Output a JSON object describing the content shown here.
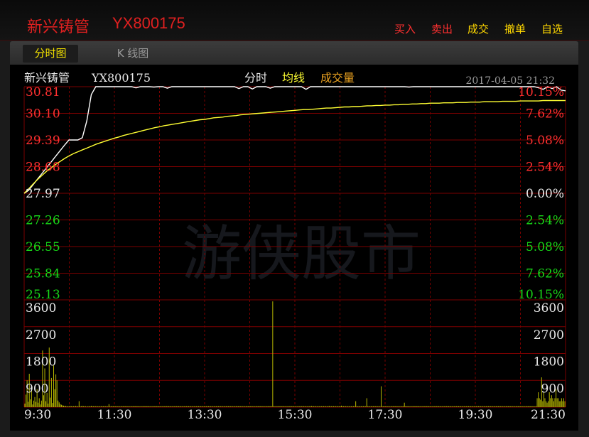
{
  "header": {
    "stock_name": "新兴铸管",
    "stock_code": "YX800175",
    "actions": [
      {
        "label": "买入",
        "color": "#ff3030"
      },
      {
        "label": "卖出",
        "color": "#ff3030"
      },
      {
        "label": "成交",
        "color": "#ffd800"
      },
      {
        "label": "撤单",
        "color": "#ffd800"
      },
      {
        "label": "自选",
        "color": "#ffd800"
      }
    ]
  },
  "tabs": [
    {
      "label": "分时图",
      "active": true
    },
    {
      "label": "K 线图",
      "active": false
    }
  ],
  "chart_info": {
    "name": "新兴铸管",
    "code": "YX800175",
    "legend_label": "分时",
    "legend_avg": "均线",
    "legend_vol": "成交量",
    "datetime": "2017-04-05 21:32"
  },
  "watermark": "游侠股市",
  "colors": {
    "up": "#ff3030",
    "down": "#18d818",
    "price_line": "#ffffff",
    "avg_line": "#ffff33",
    "volume": "#b8b800",
    "grid": "#7a0000"
  },
  "chart_data": [
    {
      "type": "line",
      "series": [
        {
          "name": "分时",
          "values": [
            27.97,
            28.05,
            28.2,
            28.35,
            28.5,
            28.65,
            28.8,
            28.95,
            29.1,
            29.25,
            29.39,
            29.39,
            29.39,
            29.45,
            29.9,
            30.6,
            30.81,
            30.81,
            30.81,
            30.81,
            30.81,
            30.81,
            30.81,
            30.81,
            30.81,
            30.78,
            30.81,
            30.81,
            30.81,
            30.8,
            30.81,
            30.81,
            30.77,
            30.81,
            30.81,
            30.81,
            30.81,
            30.81,
            30.81,
            30.81,
            30.81,
            30.81,
            30.81,
            30.81,
            30.81,
            30.81,
            30.81,
            30.81,
            30.76,
            30.81,
            30.81,
            30.75,
            30.81,
            30.81,
            30.81,
            30.77,
            30.81,
            30.81,
            30.81,
            30.81,
            30.81,
            30.81,
            30.81,
            30.74,
            30.81,
            30.81,
            30.81,
            30.81,
            30.81,
            30.81,
            30.81,
            30.81,
            30.81,
            30.81,
            30.81,
            30.81,
            30.81,
            30.81,
            30.81,
            30.81,
            30.81,
            30.81,
            30.81,
            30.81,
            30.81,
            30.81,
            30.8,
            30.81,
            30.81,
            30.81,
            30.81,
            30.81,
            30.81,
            30.81,
            30.81,
            30.81,
            30.81,
            30.81,
            30.81,
            30.81,
            30.81,
            30.81,
            30.81,
            30.81,
            30.81,
            30.81,
            30.81,
            30.81,
            30.81,
            30.81,
            30.81,
            30.81,
            30.81,
            30.81,
            30.81,
            30.78,
            30.74,
            30.81,
            30.76,
            30.81,
            30.72,
            30.7
          ]
        },
        {
          "name": "均线",
          "values": [
            27.97,
            28.09,
            28.22,
            28.34,
            28.45,
            28.56,
            28.65,
            28.74,
            28.82,
            28.9,
            28.97,
            29.03,
            29.08,
            29.13,
            29.18,
            29.23,
            29.28,
            29.32,
            29.36,
            29.4,
            29.44,
            29.47,
            29.51,
            29.54,
            29.57,
            29.6,
            29.63,
            29.66,
            29.69,
            29.72,
            29.74,
            29.77,
            29.79,
            29.81,
            29.83,
            29.85,
            29.87,
            29.89,
            29.91,
            29.93,
            29.94,
            29.96,
            29.98,
            29.99,
            30.0,
            30.02,
            30.03,
            30.04,
            30.06,
            30.07,
            30.08,
            30.09,
            30.1,
            30.11,
            30.12,
            30.13,
            30.14,
            30.15,
            30.16,
            30.17,
            30.18,
            30.19,
            30.2,
            30.2,
            30.21,
            30.22,
            30.23,
            30.24,
            30.24,
            30.25,
            30.26,
            30.27,
            30.27,
            30.28,
            30.28,
            30.29,
            30.3,
            30.3,
            30.31,
            30.31,
            30.32,
            30.32,
            30.33,
            30.33,
            30.34,
            30.34,
            30.35,
            30.35,
            30.36,
            30.36,
            30.37,
            30.37,
            30.37,
            30.38,
            30.38,
            30.38,
            30.39,
            30.39,
            30.39,
            30.4,
            30.4,
            30.4,
            30.41,
            30.41,
            30.41,
            30.41,
            30.42,
            30.42,
            30.42,
            30.42,
            30.43,
            30.43,
            30.43,
            30.43,
            30.43,
            30.44,
            30.44,
            30.44,
            30.44,
            30.44,
            30.44
          ]
        }
      ],
      "x_tick_labels": [
        "9:30",
        "11:30",
        "13:30",
        "15:30",
        "17:30",
        "19:30",
        "21:30"
      ],
      "price_ticks": [
        "30.81",
        "30.10",
        "29.39",
        "28.68",
        "27.97",
        "27.26",
        "26.55",
        "25.84",
        "25.13"
      ],
      "percent_ticks": [
        "10.15%",
        "7.62%",
        "5.08%",
        "2.54%",
        "0.00%",
        "2.54%",
        "5.08%",
        "7.62%",
        "10.15%"
      ],
      "ylim": [
        25.13,
        30.81
      ],
      "grid": true
    },
    {
      "type": "bar",
      "y_tick_labels": [
        "3600",
        "2700",
        "1800",
        "900"
      ],
      "ylim": [
        0,
        3600
      ],
      "values": [
        120,
        420,
        900,
        180,
        1120,
        260,
        640,
        90,
        220,
        340,
        180,
        600,
        150,
        300,
        90,
        220,
        1900,
        400,
        1300,
        200,
        480,
        120,
        2000,
        320,
        980,
        140,
        1400,
        600,
        1100,
        900,
        220,
        160,
        100,
        80,
        60,
        50,
        40,
        40,
        30,
        30,
        30,
        40,
        30,
        30,
        30,
        30,
        40,
        30,
        30,
        200,
        30,
        30,
        40,
        30,
        30,
        30,
        20,
        30,
        30,
        30,
        40,
        30,
        30,
        30,
        30,
        30,
        30,
        30,
        30,
        30,
        30,
        30,
        30,
        30,
        30,
        30,
        100,
        30,
        30,
        30,
        30,
        30,
        30,
        30,
        30,
        30,
        30,
        30,
        30,
        30,
        30,
        30,
        30,
        30,
        30,
        30,
        30,
        30,
        30,
        30,
        30,
        30,
        30,
        30,
        30,
        30,
        30,
        30,
        30,
        30,
        30,
        30,
        30,
        30,
        30,
        30,
        30,
        30,
        30,
        30,
        30,
        30,
        30,
        30,
        30,
        30,
        30,
        30,
        30,
        30,
        30,
        30,
        30,
        30,
        30,
        30,
        30,
        30,
        30,
        30,
        30,
        30,
        30,
        30,
        30,
        30,
        30,
        30,
        30,
        30,
        30,
        30,
        30,
        30,
        30,
        30,
        30,
        30,
        30,
        30,
        30,
        30,
        30,
        30,
        30,
        30,
        30,
        30,
        30,
        30,
        30,
        30,
        30,
        30,
        30,
        30,
        30,
        30,
        30,
        30,
        30,
        30,
        30,
        30,
        30,
        30,
        30,
        30,
        30,
        30,
        30,
        30,
        30,
        30,
        30,
        30,
        30,
        30,
        30,
        30,
        30,
        30,
        30,
        30,
        30,
        30,
        30,
        30,
        30,
        30,
        30,
        30,
        30,
        30,
        30,
        30,
        30,
        30,
        30,
        30,
        30,
        30,
        30,
        30,
        3550,
        30,
        30,
        30,
        30,
        30,
        30,
        30,
        30,
        30,
        30,
        30,
        30,
        30,
        30,
        30,
        30,
        30,
        30,
        30,
        30,
        30,
        30,
        30,
        30,
        30,
        30,
        30,
        30,
        30,
        30,
        30,
        30,
        30,
        30,
        40,
        30,
        30,
        30,
        30,
        30,
        30,
        30,
        30,
        30,
        30,
        30,
        30,
        30,
        30,
        30,
        40,
        30,
        30,
        30,
        30,
        30,
        30,
        30,
        30,
        30,
        30,
        50,
        30,
        30,
        30,
        30,
        30,
        30,
        30,
        30,
        30,
        30,
        30,
        30,
        200,
        30,
        30,
        30,
        30,
        30,
        30,
        30,
        30,
        30,
        300,
        30,
        30,
        30,
        30,
        30,
        30,
        30,
        30,
        30,
        30,
        30,
        30,
        700,
        30,
        30,
        30,
        30,
        30,
        30,
        30,
        30,
        30,
        30,
        30,
        30,
        30,
        30,
        30,
        30,
        30,
        30,
        30,
        30,
        150,
        30,
        30,
        30,
        30,
        30,
        30,
        30,
        30,
        30,
        30,
        30,
        30,
        30,
        30,
        30,
        30,
        30,
        30,
        30,
        30,
        30,
        30,
        30,
        30,
        30,
        30,
        30,
        30,
        30,
        30,
        30,
        30,
        30,
        30,
        30,
        30,
        30,
        30,
        30,
        30,
        30,
        30,
        30,
        30,
        30,
        30,
        30,
        30,
        30,
        30,
        30,
        30,
        30,
        30,
        30,
        30,
        30,
        30,
        30,
        30,
        30,
        30,
        30,
        30,
        30,
        30,
        30,
        30,
        30,
        30,
        30,
        30,
        30,
        30,
        30,
        30,
        30,
        30,
        30,
        30,
        30,
        30,
        30,
        30,
        30,
        30,
        30,
        30,
        30,
        30,
        30,
        30,
        30,
        30,
        30,
        30,
        30,
        30,
        30,
        30,
        30,
        30,
        30,
        30,
        30,
        30,
        30,
        30,
        30,
        30,
        30,
        30,
        30,
        30,
        30,
        30,
        30,
        30,
        30,
        300,
        500,
        300,
        250,
        1000,
        200,
        500,
        300,
        200,
        150,
        200,
        500,
        300,
        400,
        300,
        200,
        300,
        600,
        300,
        300,
        200,
        200,
        300,
        200,
        300,
        200
      ]
    }
  ]
}
